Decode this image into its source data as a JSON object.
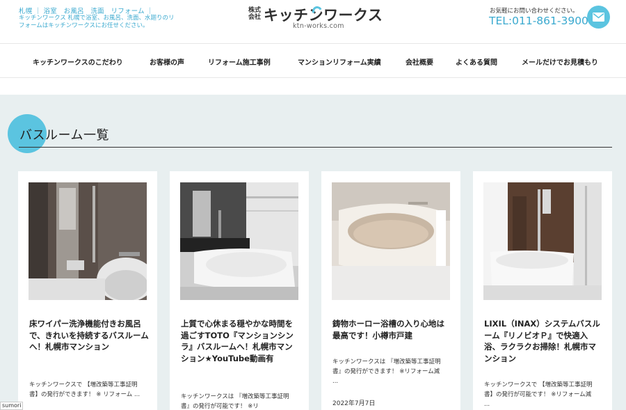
{
  "header": {
    "tagline_1": "札幌 ｜ 浴室　お風呂　洗面　リフォーム ｜",
    "tagline_2": "キッチンワークス 札幌で浴室、お風呂、洗面、水廻りのリフォームはキッチンワークスにお任せください。",
    "logo_kaisha": "株式会社",
    "logo_name": "キッチンワークス",
    "logo_url": "ktn-works.com",
    "contact_note": "お気軽にお問い合わせください。",
    "tel": "TEL:011-861-3900",
    "mail_icon": "mail-icon",
    "accent_color": "#5bc4e0"
  },
  "nav": {
    "items": [
      {
        "label": "キッチンワークスのこだわり"
      },
      {
        "label": "お客様の声"
      },
      {
        "label": "リフォーム施工事例"
      },
      {
        "label": "マンションリフォーム実績"
      },
      {
        "label": "会社概要"
      },
      {
        "label": "よくある質問"
      },
      {
        "label": "メールだけでお見積もり"
      }
    ]
  },
  "main": {
    "title": "バスルーム一覧",
    "cards": [
      {
        "title": "床ワイパー洗浄機能付きお風呂で、きれいを持続するバスルームへ！札幌市マンション",
        "excerpt": "キッチンワークスで 【増改築等工事証明書】の発行ができます！ ※ リフォーム ...",
        "date": ""
      },
      {
        "title": "上質で心休まる穏やかな時間を過ごすTOTO『マンションシンラ』バスルームへ！札幌市マンション★YouTube動画有",
        "excerpt": "キッチンワークスは 『増改築等工事証明書』の発行が可能です！ ※リ",
        "date": ""
      },
      {
        "title": "鋳物ホーロー浴槽の入り心地は最高です！小樽市戸建",
        "excerpt": "キッチンワークスは 『増改築等工事証明書』の発行ができます！ ※リフォーム減 ...",
        "date": "2022年7月7日"
      },
      {
        "title": "LIXIL（INAX）システムバスルーム『リノビオＰ』で快適入浴、ラクラクお掃除！札幌市マンション",
        "excerpt": "キッチンワークスで 【増改築等工事証明書】の発行が可能です！ ※リフォーム減 ...",
        "date": ""
      }
    ]
  },
  "footer_tag": "sumori"
}
